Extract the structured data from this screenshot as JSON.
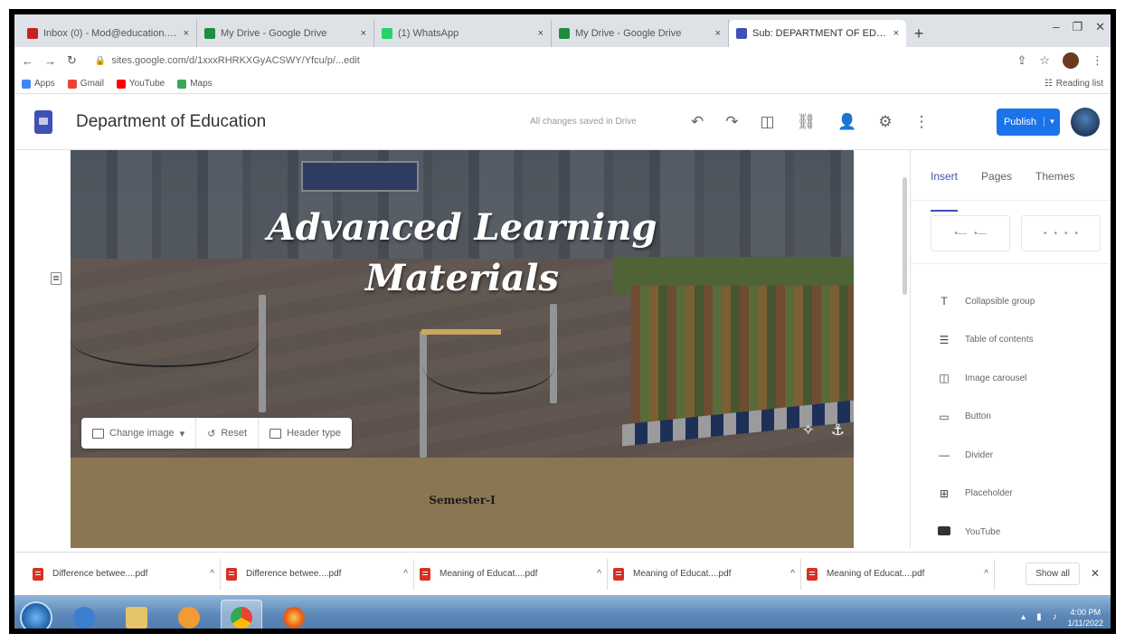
{
  "browser": {
    "tabs": [
      {
        "title": "Inbox (0) - Mod@education.gov...",
        "color": "#c5221f",
        "active": false
      },
      {
        "title": "My Drive - Google Drive",
        "color": "#1e8e3e",
        "active": false
      },
      {
        "title": "(1) WhatsApp",
        "color": "#25d366",
        "active": false
      },
      {
        "title": "My Drive - Google Drive",
        "color": "#1e8e3e",
        "active": false
      },
      {
        "title": "Sub: DEPARTMENT OF EDUCATION",
        "color": "#3f51b5",
        "active": true
      }
    ],
    "tab_close": "×",
    "new_tab": "+",
    "window_controls": [
      "–",
      "❐",
      "✕"
    ],
    "nav": {
      "back": "←",
      "forward": "→",
      "reload": "↻"
    },
    "url": "sites.google.com/d/1xxxRHRKXGyACSWY/Yfcu/p/...edit",
    "bookmarks": [
      {
        "label": "Apps",
        "color": "#4285f4"
      },
      {
        "label": "Gmail",
        "color": "#ea4335"
      },
      {
        "label": "YouTube",
        "color": "#ff0000"
      },
      {
        "label": "Maps",
        "color": "#34a853"
      }
    ],
    "reading_list": "Reading list"
  },
  "app": {
    "title": "Department of Education",
    "saved_status": "All changes saved in Drive",
    "toolbar_icons": {
      "undo": "↶",
      "redo": "↷",
      "preview": "◫",
      "link": "⛓",
      "share": "👤",
      "settings": "⚙",
      "more": "⋮"
    },
    "publish_label": "Publish",
    "publish_dropdown": "▾"
  },
  "hero": {
    "title_line1": "Advanced Learning",
    "title_line2": "Materials",
    "accent_color": "#c8a95c",
    "toolbar": {
      "change_image": "Change image",
      "change_image_caret": "▾",
      "reset": "Reset",
      "header_type": "Header type"
    },
    "fab_icons": {
      "magic": "✧",
      "anchor": "⚓"
    }
  },
  "section": {
    "label": "Semester-I",
    "background": "#8b7653"
  },
  "panel": {
    "tabs": [
      "Insert",
      "Pages",
      "Themes"
    ],
    "active_tab": "Insert",
    "items": [
      {
        "label": "Collapsible group",
        "icon": "T"
      },
      {
        "label": "Table of contents",
        "icon": "☰"
      },
      {
        "label": "Image carousel",
        "icon": "◫"
      },
      {
        "label": "Button",
        "icon": "▭"
      },
      {
        "label": "Divider",
        "icon": "—"
      },
      {
        "label": "Placeholder",
        "icon": "⊞"
      },
      {
        "label": "YouTube",
        "icon": "yt"
      }
    ]
  },
  "downloads": {
    "files": [
      "Difference betwee....pdf",
      "Difference betwee....pdf",
      "Meaning of Educat....pdf",
      "Meaning of Educat....pdf",
      "Meaning of Educat....pdf"
    ],
    "caret": "^",
    "show_all": "Show all",
    "close": "✕"
  },
  "taskbar": {
    "clock_time": "4:00 PM",
    "clock_date": "1/11/2022"
  }
}
